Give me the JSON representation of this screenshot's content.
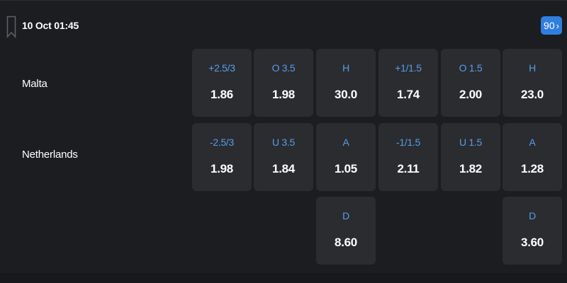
{
  "match": {
    "datetime": "10 Oct 01:45",
    "more_count": "90",
    "more_chevron": "›",
    "home_team": "Malta",
    "away_team": "Netherlands"
  },
  "markets": {
    "home": [
      {
        "label": "+2.5/3",
        "odds": "1.86"
      },
      {
        "label": "O 3.5",
        "odds": "1.98"
      },
      {
        "label": "H",
        "odds": "30.0"
      },
      {
        "label": "+1/1.5",
        "odds": "1.74"
      },
      {
        "label": "O 1.5",
        "odds": "2.00"
      },
      {
        "label": "H",
        "odds": "23.0"
      }
    ],
    "away": [
      {
        "label": "-2.5/3",
        "odds": "1.98"
      },
      {
        "label": "U 3.5",
        "odds": "1.84"
      },
      {
        "label": "A",
        "odds": "1.05"
      },
      {
        "label": "-1/1.5",
        "odds": "2.11"
      },
      {
        "label": "U 1.5",
        "odds": "1.82"
      },
      {
        "label": "A",
        "odds": "1.28"
      }
    ],
    "draw_fulltime": {
      "label": "D",
      "odds": "8.60"
    },
    "draw_firsthalf": {
      "label": "D",
      "odds": "3.60"
    }
  },
  "icons": {
    "bookmark": "bookmark-icon",
    "chevron": "chevron-right-icon"
  },
  "colors": {
    "background": "#1b1d20",
    "cell": "#2a2c30",
    "label": "#5b9be8",
    "accent": "#2f7fe0"
  }
}
